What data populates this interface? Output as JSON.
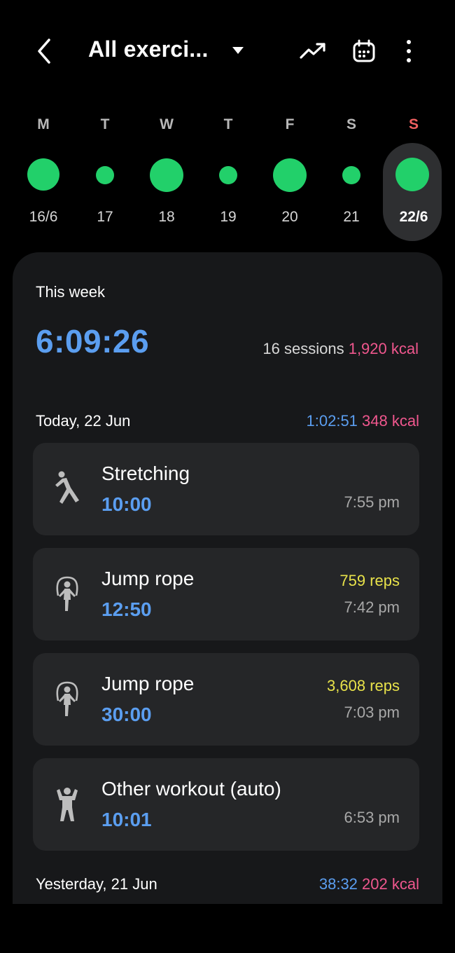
{
  "header": {
    "title": "All exerci...",
    "icons": [
      "back-icon",
      "dropdown-icon",
      "trend-icon",
      "calendar-icon",
      "more-icon"
    ]
  },
  "week_days": [
    {
      "letter": "M",
      "date": "16/6"
    },
    {
      "letter": "T",
      "date": "17"
    },
    {
      "letter": "W",
      "date": "18"
    },
    {
      "letter": "T",
      "date": "19"
    },
    {
      "letter": "F",
      "date": "20"
    },
    {
      "letter": "S",
      "date": "21"
    },
    {
      "letter": "S",
      "date": "22/6"
    }
  ],
  "summary": {
    "label": "This week",
    "duration": "6:09:26",
    "sessions": "16 sessions",
    "kcal": "1,920 kcal"
  },
  "today": {
    "label": "Today, 22 Jun",
    "duration": "1:02:51",
    "kcal": "348 kcal"
  },
  "exercises": [
    {
      "name": "Stretching",
      "duration": "10:00",
      "reps": "",
      "time": "7:55 pm",
      "icon": "stretching-icon"
    },
    {
      "name": "Jump rope",
      "duration": "12:50",
      "reps": "759 reps",
      "time": "7:42 pm",
      "icon": "jump-rope-icon"
    },
    {
      "name": "Jump rope",
      "duration": "30:00",
      "reps": "3,608 reps",
      "time": "7:03 pm",
      "icon": "jump-rope-icon"
    },
    {
      "name": "Other workout (auto)",
      "duration": "10:01",
      "reps": "",
      "time": "6:53 pm",
      "icon": "workout-icon"
    }
  ],
  "yesterday": {
    "label": "Yesterday, 21 Jun",
    "duration": "38:32",
    "kcal": "202 kcal"
  },
  "colors": {
    "accent_blue": "#5b9ef0",
    "active_green": "#22d06a",
    "kcal_pink": "#f0578e",
    "reps_yellow": "#e8e24a",
    "sunday_red": "#f06060"
  }
}
